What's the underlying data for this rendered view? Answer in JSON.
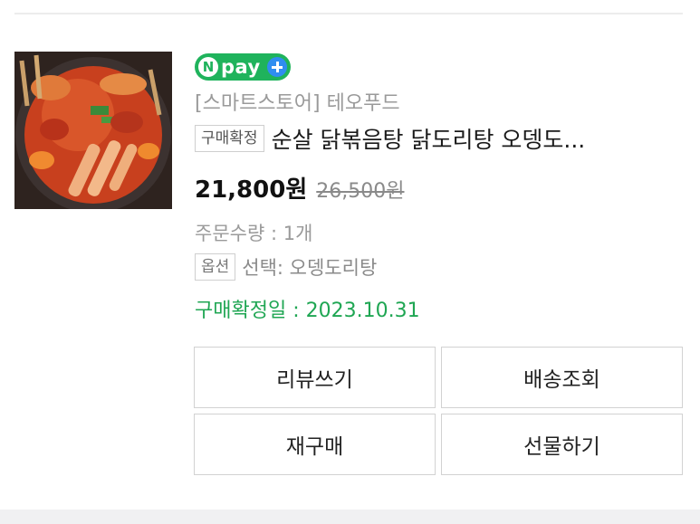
{
  "order": {
    "pay_badge": {
      "n_letter": "N",
      "text": "pay",
      "brand_color": "#1fb35c",
      "plus_color": "#2f8df0"
    },
    "store_name": "[스마트스토어] 테오푸드",
    "status_badge": "구매확정",
    "product_title": "순살 닭볶음탕 닭도리탕 오뎅도...",
    "price": "21,800원",
    "original_price": "26,500원",
    "quantity": "주문수량 : 1개",
    "option_badge": "옵션",
    "option_value": "선택: 오뎅도리탕",
    "confirm_date": "구매확정일 : 2023.10.31",
    "confirm_color": "#1fa653"
  },
  "actions": {
    "review": "리뷰쓰기",
    "shipping": "배송조회",
    "rebuy": "재구매",
    "gift": "선물하기"
  }
}
